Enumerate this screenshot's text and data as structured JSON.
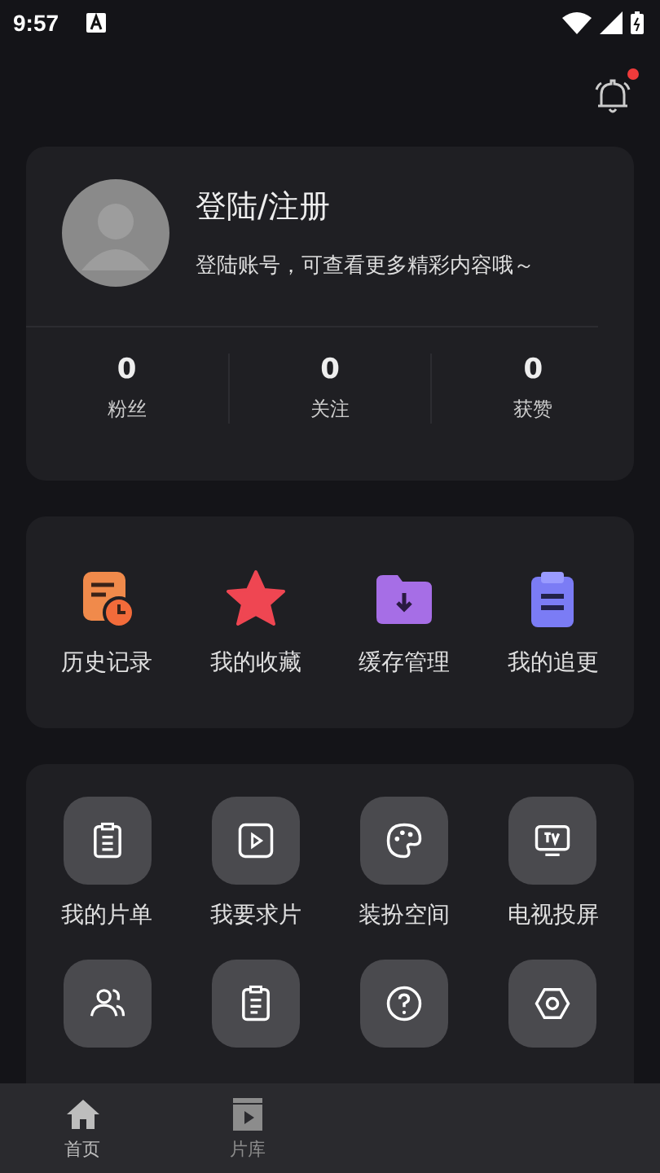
{
  "status_bar": {
    "time": "9:57"
  },
  "notifications": {
    "unread": true
  },
  "profile": {
    "title": "登陆/注册",
    "subtitle": "登陆账号，可查看更多精彩内容哦～",
    "stats": [
      {
        "value": "0",
        "label": "粉丝"
      },
      {
        "value": "0",
        "label": "关注"
      },
      {
        "value": "0",
        "label": "获赞"
      }
    ]
  },
  "quick_actions": [
    {
      "kind": "history",
      "label": "历史记录"
    },
    {
      "kind": "favorites",
      "label": "我的收藏"
    },
    {
      "kind": "cache",
      "label": "缓存管理"
    },
    {
      "kind": "following",
      "label": "我的追更"
    }
  ],
  "tools": [
    {
      "kind": "list",
      "label": "我的片单"
    },
    {
      "kind": "request",
      "label": "我要求片"
    },
    {
      "kind": "theme",
      "label": "装扮空间"
    },
    {
      "kind": "tv",
      "label": "电视投屏"
    },
    {
      "kind": "invite"
    },
    {
      "kind": "records"
    },
    {
      "kind": "help"
    },
    {
      "kind": "settings"
    }
  ],
  "tab_bar": [
    {
      "kind": "home",
      "label": "首页",
      "selected": true
    },
    {
      "kind": "library",
      "label": "片库",
      "selected": false
    }
  ]
}
